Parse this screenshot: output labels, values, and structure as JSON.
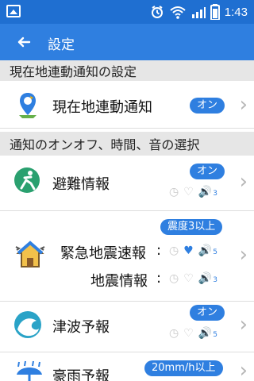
{
  "status_bar": {
    "time": "1:43",
    "icons": [
      "image-icon",
      "alarm-icon",
      "wifi-icon",
      "signal-icon",
      "battery-icon"
    ]
  },
  "app_bar": {
    "back_icon": "arrow-left-icon",
    "title": "設定"
  },
  "sections": [
    {
      "title": "現在地連動通知の設定"
    },
    {
      "title": "通知のオンオフ、時間、音の選択"
    }
  ],
  "rows": {
    "current_location": {
      "label": "現在地連動通知",
      "pill": "オン"
    },
    "evacuation": {
      "label": "避難情報",
      "pill": "オン",
      "volume": "3"
    },
    "earthquake": {
      "label_1": "緊急地震速報",
      "label_2": "地震情報",
      "pill": "震度3以上",
      "volume_1": "5",
      "volume_2": "3"
    },
    "tsunami": {
      "label": "津波予報",
      "pill": "オン",
      "volume": "5"
    },
    "heavy_rain": {
      "label": "豪雨予報",
      "pill": "20mm/h以上"
    }
  },
  "colors": {
    "primary": "#2f7fe0",
    "status": "#1f6fd1"
  }
}
